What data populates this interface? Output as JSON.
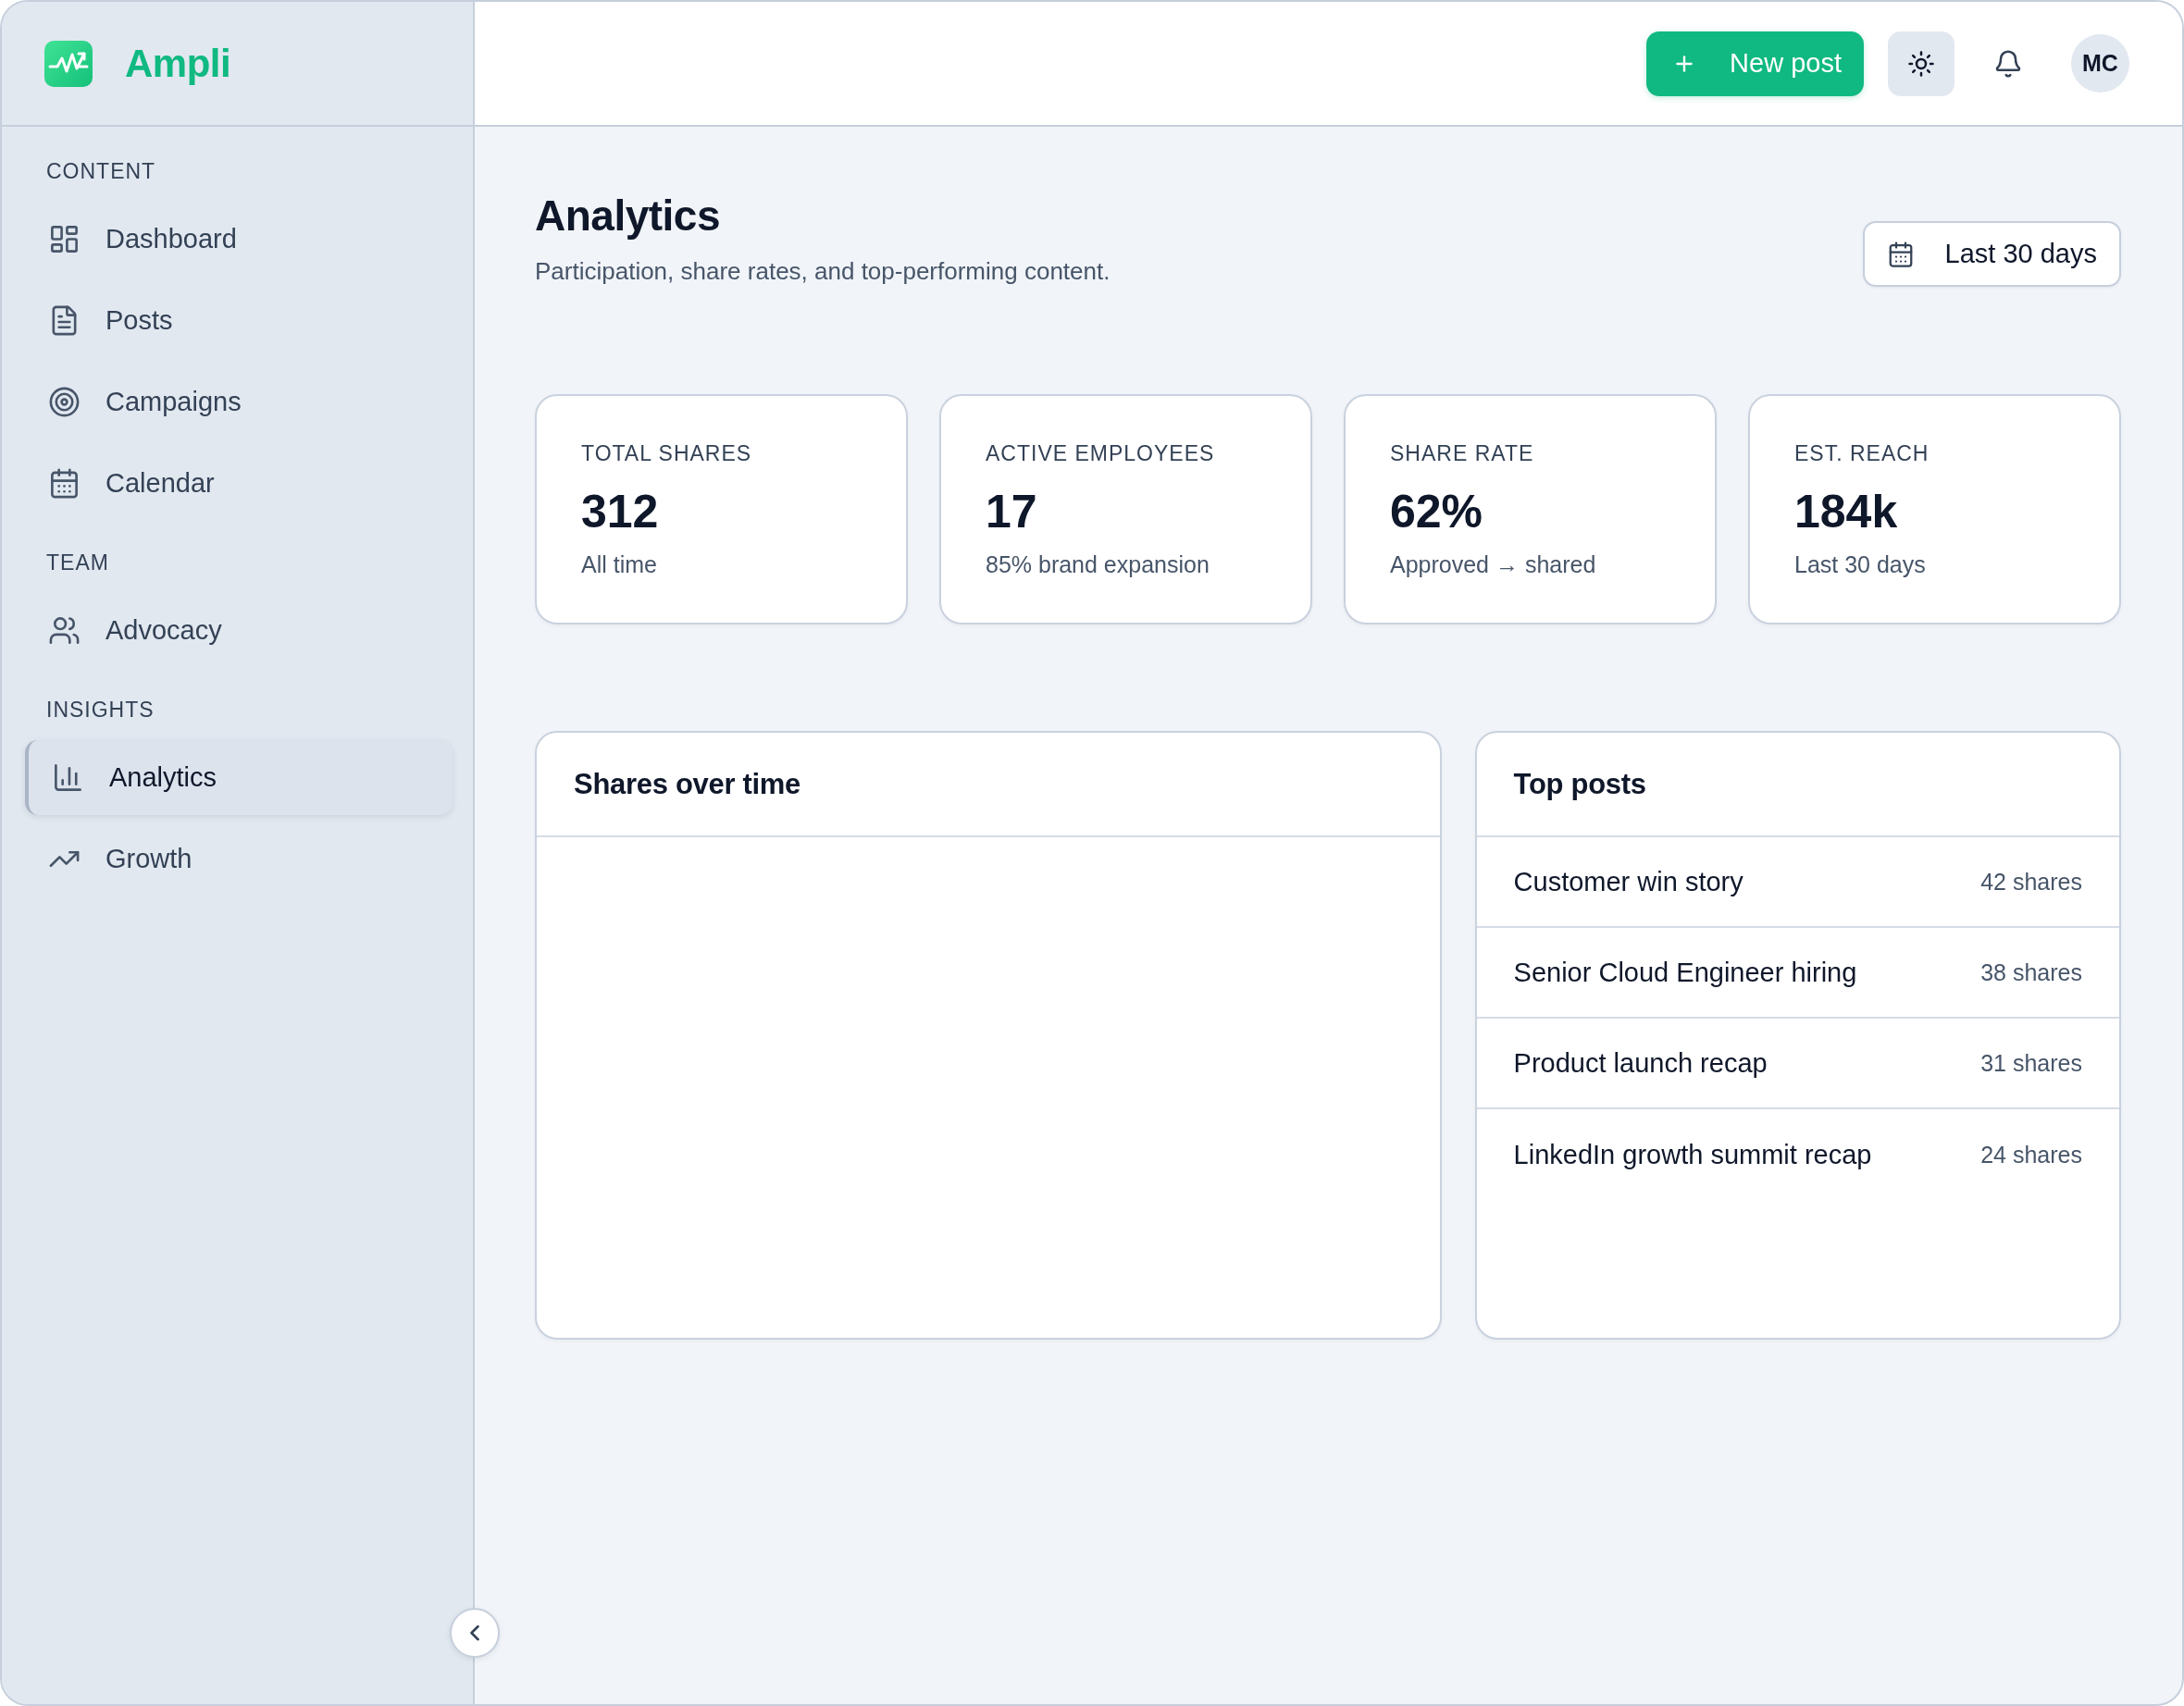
{
  "sidebar": {
    "brand": "Ampli",
    "sections": [
      {
        "heading": "CONTENT",
        "items": [
          {
            "label": "Dashboard",
            "selected": false
          },
          {
            "label": "Posts",
            "selected": false
          },
          {
            "label": "Campaigns",
            "selected": false
          },
          {
            "label": "Calendar",
            "selected": false
          }
        ]
      },
      {
        "heading": "TEAM",
        "items": [
          {
            "label": "Advocacy",
            "selected": false
          }
        ]
      },
      {
        "heading": "INSIGHTS",
        "items": [
          {
            "label": "Analytics",
            "selected": true
          },
          {
            "label": "Growth",
            "selected": false
          }
        ]
      }
    ]
  },
  "header": {
    "new_post_button": "New post",
    "avatar": "MC"
  },
  "page": {
    "title": "Analytics",
    "subtitle": "Participation, share rates, and top-performing content.",
    "date_range_button": "Last 30 days"
  },
  "stats": [
    {
      "label": "TOTAL SHARES",
      "value": "312",
      "note": "All time"
    },
    {
      "label": "ACTIVE EMPLOYEES",
      "value": "17",
      "note": "85% brand expansion"
    },
    {
      "label": "SHARE RATE",
      "value": "62%",
      "note": "Approved → shared"
    },
    {
      "label": "EST. REACH",
      "value": "184k",
      "note": "Last 30 days"
    }
  ],
  "shares_over_time": {
    "title": "Shares over time"
  },
  "top_posts": {
    "title": "Top posts",
    "rows": [
      {
        "title": "Customer win story",
        "shares": "42 shares"
      },
      {
        "title": "Senior Cloud Engineer hiring",
        "shares": "38 shares"
      },
      {
        "title": "Product launch recap",
        "shares": "31 shares"
      },
      {
        "title": "LinkedIn growth summit recap",
        "shares": "24 shares"
      }
    ]
  }
}
